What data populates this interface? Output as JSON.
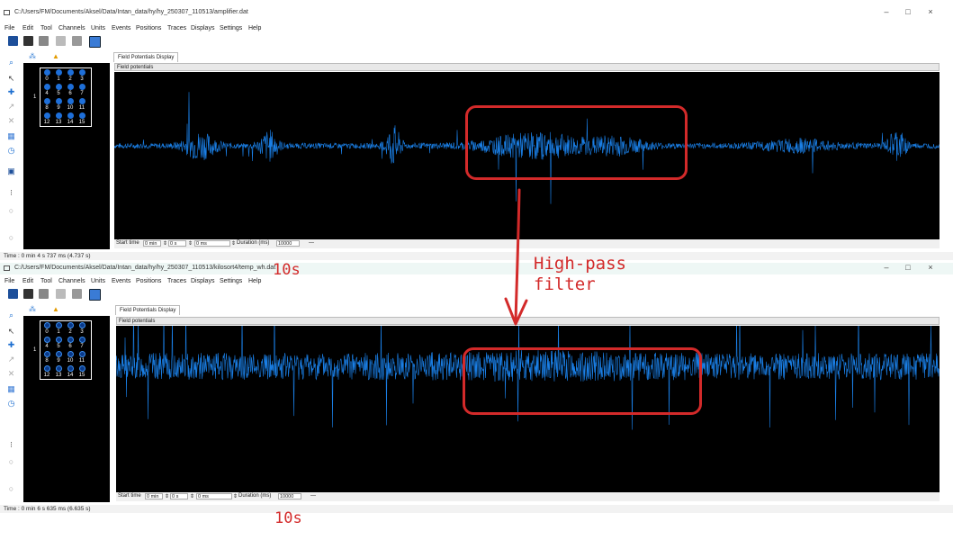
{
  "windows": [
    {
      "path": "C:/Users/FM/Documents/Aksel/Data/Intan_data/hy/hy_250307_110513/amplifier.dat",
      "controls": [
        "–",
        "□",
        "×"
      ],
      "menu": [
        "File",
        "Edit",
        "Tool",
        "Channels",
        "Units",
        "Events",
        "Positions",
        "Traces",
        "Displays",
        "Settings",
        "Help"
      ],
      "tab": "Field Potentials Display",
      "plot_label": "Field potentials",
      "start_time_label": "Start time",
      "start_min": "0 min",
      "start_s": "0 s",
      "start_ms": "0 ms",
      "duration_label": "Duration (ms)",
      "duration_value": "10000",
      "status": "Time : 0 min 4 s 737 ms (4.737 s)"
    },
    {
      "path": "C:/Users/FM/Documents/Aksel/Data/Intan_data/hy/hy_250307_110513/kilosort4/temp_wh.dat",
      "controls": [
        "–",
        "□",
        "×"
      ],
      "menu": [
        "File",
        "Edit",
        "Tool",
        "Channels",
        "Units",
        "Events",
        "Positions",
        "Traces",
        "Displays",
        "Settings",
        "Help"
      ],
      "tab": "Field Potentials Display",
      "plot_label": "Field potentials",
      "start_time_label": "Start time",
      "start_min": "0 min",
      "start_s": "0 s",
      "start_ms": "0 ms",
      "duration_label": "Duration (ms)",
      "duration_value": "10000",
      "status": "Time : 0 min 6 s 635 ms (6.635 s)"
    }
  ],
  "channel_grid": {
    "group_label": "1",
    "channels": [
      "0",
      "1",
      "2",
      "3",
      "4",
      "5",
      "6",
      "7",
      "8",
      "9",
      "10",
      "11",
      "12",
      "13",
      "14",
      "15"
    ]
  },
  "annotations": {
    "top_duration": "10s",
    "bottom_duration": "10s",
    "filter_line1": "High-pass",
    "filter_line2": "filter"
  },
  "colors": {
    "trace": "#1a7fe6",
    "annotation": "#d32a2a",
    "plot_bg": "#000000",
    "channel_dot": "#1e6fd9"
  },
  "icons": {
    "top_level_tabs": [
      "channels-group-icon",
      "warning-triangle-icon"
    ],
    "toolbar": [
      "open-icon",
      "save-icon",
      "print-icon",
      "undo-icon",
      "redo-icon",
      "display-icon"
    ],
    "sidebar": [
      "zoom-icon",
      "select-icon",
      "measure-icon",
      "pan-icon",
      "correlation-icon",
      "calendar-icon",
      "clock-icon",
      "event-icon",
      "more-icon",
      "circle-icon",
      "circle-icon"
    ]
  }
}
